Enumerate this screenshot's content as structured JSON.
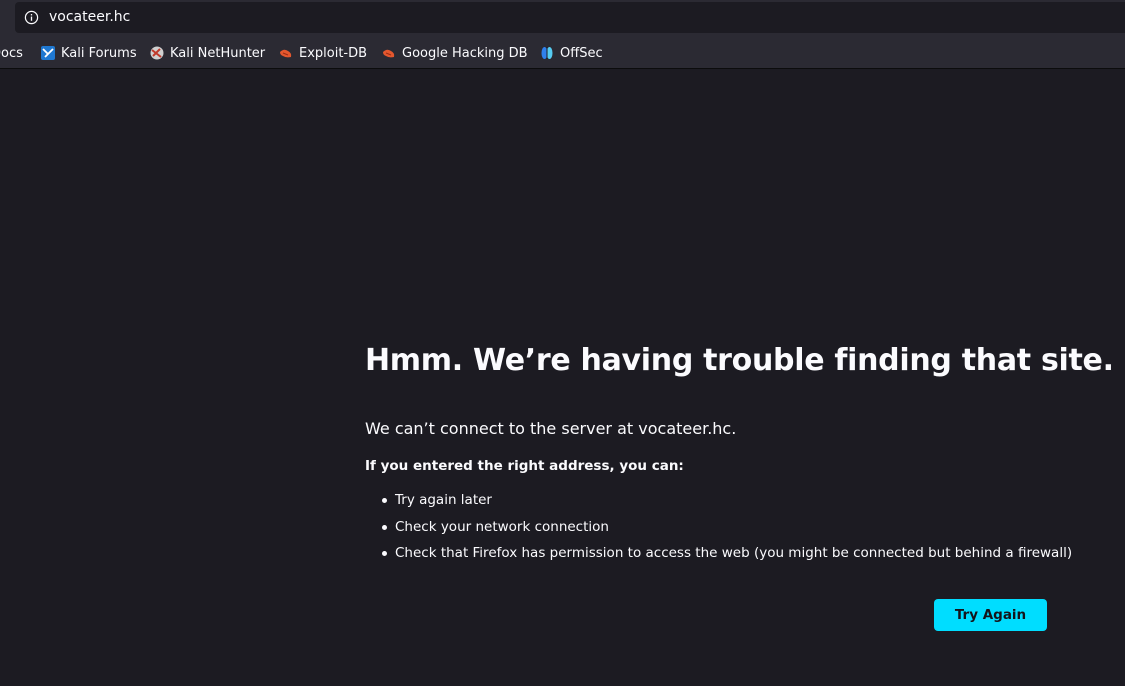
{
  "urlbar": {
    "info_icon": "info-icon",
    "url": "vocateer.hc"
  },
  "bookmarks": {
    "items": [
      {
        "label": "Docs",
        "icon": null
      },
      {
        "label": "Kali Forums",
        "icon": "kali-dragon-icon"
      },
      {
        "label": "Kali NetHunter",
        "icon": "nethunter-icon"
      },
      {
        "label": "Exploit-DB",
        "icon": "exploit-db-icon"
      },
      {
        "label": "Google Hacking DB",
        "icon": "exploit-db-icon"
      },
      {
        "label": "OffSec",
        "icon": "offsec-icon"
      }
    ]
  },
  "error_page": {
    "title": "Hmm. We’re having trouble finding that site.",
    "description": "We can’t connect to the server at vocateer.hc.",
    "subheading": "If you entered the right address, you can:",
    "suggestions": [
      "Try again later",
      "Check your network connection",
      "Check that Firefox has permission to access the web (you might be connected but behind a firewall)"
    ],
    "try_again_label": "Try Again"
  },
  "colors": {
    "background": "#1c1b22",
    "toolbar": "#2b2a33",
    "accent_button": "#00ddff",
    "text": "#fbfbfe"
  }
}
